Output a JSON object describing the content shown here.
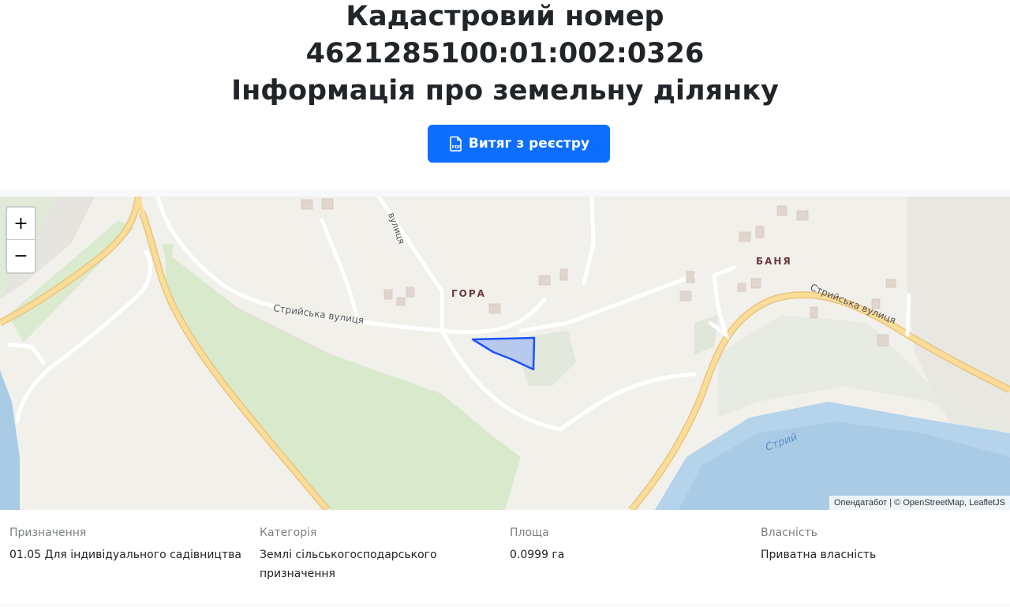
{
  "header": {
    "title_line1": "Кадастровий номер",
    "title_line2": "4621285100:01:002:0326",
    "title_line3": "Інформація про земельну ділянку"
  },
  "extract_button": {
    "label": "Витяг з реєстру",
    "icon": "pdf-file-icon",
    "color": "#0d6efd"
  },
  "map": {
    "zoom_in": "+",
    "zoom_out": "−",
    "place_labels": [
      "ГОРА",
      "БАНЯ"
    ],
    "street_labels": [
      "Стрийська вулиця",
      "Стрийська вулиця",
      "вулиця"
    ],
    "river_label": "Стрий",
    "attribution": {
      "part1": "Опендатабот",
      "separator": "|",
      "part2": "© OpenStreetMap, LeafletJS"
    },
    "parcel_color": "#1a53ff"
  },
  "info": {
    "purpose": {
      "label": "Призначення",
      "value": "01.05 Для індивідуального садівництва"
    },
    "category": {
      "label": "Категорія",
      "value_line1": "Землі сільськогосподарського",
      "value_line2": "призначення"
    },
    "area": {
      "label": "Площа",
      "value": "0.0999 га"
    },
    "ownership": {
      "label": "Власність",
      "value": "Приватна власність"
    }
  }
}
